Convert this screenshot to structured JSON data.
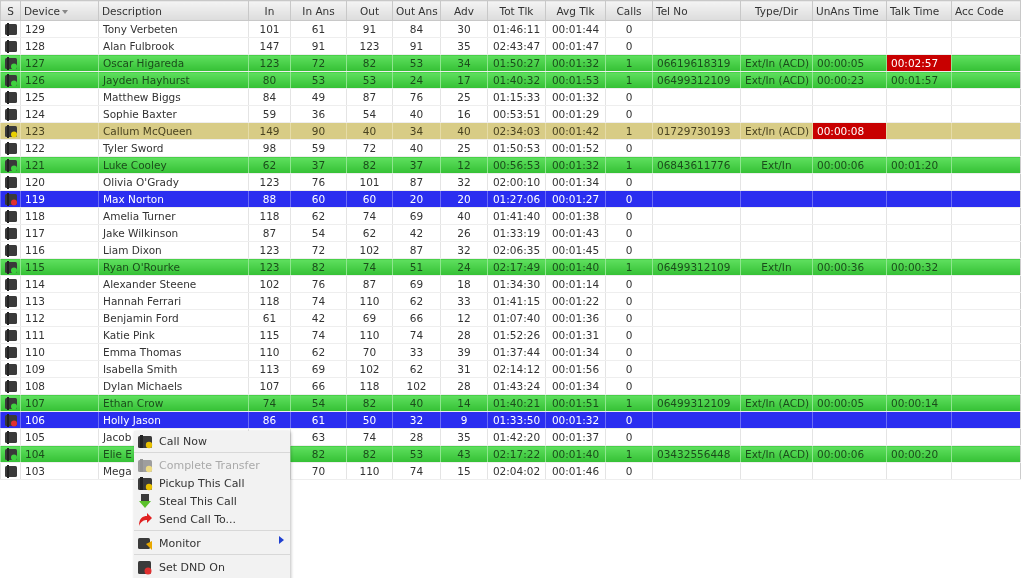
{
  "columns": [
    {
      "label": "S",
      "sorted": false
    },
    {
      "label": "Device",
      "sorted": true
    },
    {
      "label": "Description",
      "sorted": false
    },
    {
      "label": "In",
      "sorted": false
    },
    {
      "label": "In Ans",
      "sorted": false
    },
    {
      "label": "Out",
      "sorted": false
    },
    {
      "label": "Out Ans",
      "sorted": false
    },
    {
      "label": "Adv",
      "sorted": false
    },
    {
      "label": "Tot Tlk",
      "sorted": false
    },
    {
      "label": "Avg Tlk",
      "sorted": false
    },
    {
      "label": "Calls",
      "sorted": false
    },
    {
      "label": "Tel No",
      "sorted": false
    },
    {
      "label": "Type/Dir",
      "sorted": false
    },
    {
      "label": "UnAns Time",
      "sorted": false
    },
    {
      "label": "Talk Time",
      "sorted": false
    },
    {
      "label": "Acc Code",
      "sorted": false
    }
  ],
  "rows": [
    {
      "kind": "idle",
      "device": "129",
      "description": "Tony Verbeten",
      "in": "101",
      "in_ans": "61",
      "out": "91",
      "out_ans": "84",
      "adv": "30",
      "tot_tlk": "01:46:11",
      "avg_tlk": "00:01:44",
      "calls": "0"
    },
    {
      "kind": "idle",
      "device": "128",
      "description": "Alan Fulbrook",
      "in": "147",
      "in_ans": "91",
      "out": "123",
      "out_ans": "91",
      "adv": "35",
      "tot_tlk": "02:43:47",
      "avg_tlk": "00:01:47",
      "calls": "0"
    },
    {
      "kind": "talking",
      "device": "127",
      "description": "Oscar Higareda",
      "in": "123",
      "in_ans": "72",
      "out": "82",
      "out_ans": "53",
      "adv": "34",
      "tot_tlk": "01:50:27",
      "avg_tlk": "00:01:32",
      "calls": "1",
      "tel_no": "06619618319",
      "type_dir": "Ext/In (ACD)",
      "unans_time": {
        "text": "00:00:05",
        "alert": false
      },
      "talk_time": {
        "text": "00:02:57",
        "alert": true
      }
    },
    {
      "kind": "talking",
      "device": "126",
      "description": "Jayden Hayhurst",
      "in": "80",
      "in_ans": "53",
      "out": "53",
      "out_ans": "24",
      "adv": "17",
      "tot_tlk": "01:40:32",
      "avg_tlk": "00:01:53",
      "calls": "1",
      "tel_no": "06499312109",
      "type_dir": "Ext/In (ACD)",
      "unans_time": {
        "text": "00:00:23",
        "alert": false
      },
      "talk_time": {
        "text": "00:01:57",
        "alert": false
      }
    },
    {
      "kind": "idle",
      "device": "125",
      "description": "Matthew Biggs",
      "in": "84",
      "in_ans": "49",
      "out": "87",
      "out_ans": "76",
      "adv": "25",
      "tot_tlk": "01:15:33",
      "avg_tlk": "00:01:32",
      "calls": "0"
    },
    {
      "kind": "idle",
      "device": "124",
      "description": "Sophie Baxter",
      "in": "59",
      "in_ans": "36",
      "out": "54",
      "out_ans": "40",
      "adv": "16",
      "tot_tlk": "00:53:51",
      "avg_tlk": "00:01:29",
      "calls": "0"
    },
    {
      "kind": "ringing",
      "device": "123",
      "description": "Callum McQueen",
      "in": "149",
      "in_ans": "90",
      "out": "40",
      "out_ans": "34",
      "adv": "40",
      "tot_tlk": "02:34:03",
      "avg_tlk": "00:01:42",
      "calls": "1",
      "tel_no": "01729730193",
      "type_dir": "Ext/In (ACD)",
      "unans_time": {
        "text": "00:00:08",
        "alert": true
      }
    },
    {
      "kind": "idle",
      "device": "122",
      "description": "Tyler Sword",
      "in": "98",
      "in_ans": "59",
      "out": "72",
      "out_ans": "40",
      "adv": "25",
      "tot_tlk": "01:50:53",
      "avg_tlk": "00:01:52",
      "calls": "0"
    },
    {
      "kind": "talking",
      "device": "121",
      "description": "Luke Cooley",
      "in": "62",
      "in_ans": "37",
      "out": "82",
      "out_ans": "37",
      "adv": "12",
      "tot_tlk": "00:56:53",
      "avg_tlk": "00:01:32",
      "calls": "1",
      "tel_no": "06843611776",
      "type_dir": "Ext/In",
      "unans_time": {
        "text": "00:00:06",
        "alert": false
      },
      "talk_time": {
        "text": "00:01:20",
        "alert": false
      }
    },
    {
      "kind": "idle",
      "device": "120",
      "description": "Olivia O'Grady",
      "in": "123",
      "in_ans": "76",
      "out": "101",
      "out_ans": "87",
      "adv": "32",
      "tot_tlk": "02:00:10",
      "avg_tlk": "00:01:34",
      "calls": "0"
    },
    {
      "kind": "dnd",
      "device": "119",
      "description": "Max Norton",
      "in": "88",
      "in_ans": "60",
      "out": "60",
      "out_ans": "20",
      "adv": "20",
      "tot_tlk": "01:27:06",
      "avg_tlk": "00:01:27",
      "calls": "0"
    },
    {
      "kind": "idle",
      "device": "118",
      "description": "Amelia Turner",
      "in": "118",
      "in_ans": "62",
      "out": "74",
      "out_ans": "69",
      "adv": "40",
      "tot_tlk": "01:41:40",
      "avg_tlk": "00:01:38",
      "calls": "0"
    },
    {
      "kind": "idle",
      "device": "117",
      "description": "Jake Wilkinson",
      "in": "87",
      "in_ans": "54",
      "out": "62",
      "out_ans": "42",
      "adv": "26",
      "tot_tlk": "01:33:19",
      "avg_tlk": "00:01:43",
      "calls": "0"
    },
    {
      "kind": "idle",
      "device": "116",
      "description": "Liam Dixon",
      "in": "123",
      "in_ans": "72",
      "out": "102",
      "out_ans": "87",
      "adv": "32",
      "tot_tlk": "02:06:35",
      "avg_tlk": "00:01:45",
      "calls": "0"
    },
    {
      "kind": "talking",
      "device": "115",
      "description": "Ryan O'Rourke",
      "in": "123",
      "in_ans": "82",
      "out": "74",
      "out_ans": "51",
      "adv": "24",
      "tot_tlk": "02:17:49",
      "avg_tlk": "00:01:40",
      "calls": "1",
      "tel_no": "06499312109",
      "type_dir": "Ext/In",
      "unans_time": {
        "text": "00:00:36",
        "alert": false
      },
      "talk_time": {
        "text": "00:00:32",
        "alert": false
      }
    },
    {
      "kind": "idle",
      "device": "114",
      "description": "Alexander Steene",
      "in": "102",
      "in_ans": "76",
      "out": "87",
      "out_ans": "69",
      "adv": "18",
      "tot_tlk": "01:34:30",
      "avg_tlk": "00:01:14",
      "calls": "0"
    },
    {
      "kind": "idle",
      "device": "113",
      "description": "Hannah Ferrari",
      "in": "118",
      "in_ans": "74",
      "out": "110",
      "out_ans": "62",
      "adv": "33",
      "tot_tlk": "01:41:15",
      "avg_tlk": "00:01:22",
      "calls": "0"
    },
    {
      "kind": "idle",
      "device": "112",
      "description": "Benjamin Ford",
      "in": "61",
      "in_ans": "42",
      "out": "69",
      "out_ans": "66",
      "adv": "12",
      "tot_tlk": "01:07:40",
      "avg_tlk": "00:01:36",
      "calls": "0"
    },
    {
      "kind": "idle",
      "device": "111",
      "description": "Katie Pink",
      "in": "115",
      "in_ans": "74",
      "out": "110",
      "out_ans": "74",
      "adv": "28",
      "tot_tlk": "01:52:26",
      "avg_tlk": "00:01:31",
      "calls": "0"
    },
    {
      "kind": "idle",
      "device": "110",
      "description": "Emma Thomas",
      "in": "110",
      "in_ans": "62",
      "out": "70",
      "out_ans": "33",
      "adv": "39",
      "tot_tlk": "01:37:44",
      "avg_tlk": "00:01:34",
      "calls": "0"
    },
    {
      "kind": "idle",
      "device": "109",
      "description": "Isabella Smith",
      "in": "113",
      "in_ans": "69",
      "out": "102",
      "out_ans": "62",
      "adv": "31",
      "tot_tlk": "02:14:12",
      "avg_tlk": "00:01:56",
      "calls": "0"
    },
    {
      "kind": "idle",
      "device": "108",
      "description": "Dylan Michaels",
      "in": "107",
      "in_ans": "66",
      "out": "118",
      "out_ans": "102",
      "adv": "28",
      "tot_tlk": "01:43:24",
      "avg_tlk": "00:01:34",
      "calls": "0"
    },
    {
      "kind": "talking",
      "device": "107",
      "description": "Ethan Crow",
      "in": "74",
      "in_ans": "54",
      "out": "82",
      "out_ans": "40",
      "adv": "14",
      "tot_tlk": "01:40:21",
      "avg_tlk": "00:01:51",
      "calls": "1",
      "tel_no": "06499312109",
      "type_dir": "Ext/In (ACD)",
      "unans_time": {
        "text": "00:00:05",
        "alert": false
      },
      "talk_time": {
        "text": "00:00:14",
        "alert": false
      }
    },
    {
      "kind": "dnd",
      "device": "106",
      "description": "Holly Jason",
      "in": "86",
      "in_ans": "61",
      "out": "50",
      "out_ans": "32",
      "adv": "9",
      "tot_tlk": "01:33:50",
      "avg_tlk": "00:01:32",
      "calls": "0"
    },
    {
      "kind": "idle",
      "device": "105",
      "description": "Jacob",
      "in_ans": "63",
      "out": "74",
      "out_ans": "28",
      "adv": "35",
      "tot_tlk": "01:42:20",
      "avg_tlk": "00:01:37",
      "calls": "0"
    },
    {
      "kind": "talking",
      "device": "104",
      "description": "Elie E",
      "in_ans": "82",
      "out": "82",
      "out_ans": "53",
      "adv": "43",
      "tot_tlk": "02:17:22",
      "avg_tlk": "00:01:40",
      "calls": "1",
      "tel_no": "03432556448",
      "type_dir": "Ext/In (ACD)",
      "unans_time": {
        "text": "00:00:06",
        "alert": false
      },
      "talk_time": {
        "text": "00:00:20",
        "alert": false
      }
    },
    {
      "kind": "idle",
      "device": "103",
      "description": "Mega",
      "in_ans": "70",
      "out": "110",
      "out_ans": "74",
      "adv": "15",
      "tot_tlk": "02:04:02",
      "avg_tlk": "00:01:46",
      "calls": "0"
    }
  ],
  "context_menu": [
    {
      "label": "Call Now",
      "disabled": false,
      "submenu": false,
      "separator_before": false
    },
    {
      "label": "Complete Transfer",
      "disabled": true,
      "submenu": false,
      "separator_before": true
    },
    {
      "label": "Pickup This Call",
      "disabled": false,
      "submenu": false,
      "separator_before": false
    },
    {
      "label": "Steal This Call",
      "disabled": false,
      "submenu": false,
      "separator_before": false
    },
    {
      "label": "Send Call To...",
      "disabled": false,
      "submenu": false,
      "separator_before": false
    },
    {
      "label": "Monitor",
      "disabled": false,
      "submenu": true,
      "separator_before": true
    },
    {
      "label": "Set DND On",
      "disabled": false,
      "submenu": false,
      "separator_before": true
    }
  ]
}
